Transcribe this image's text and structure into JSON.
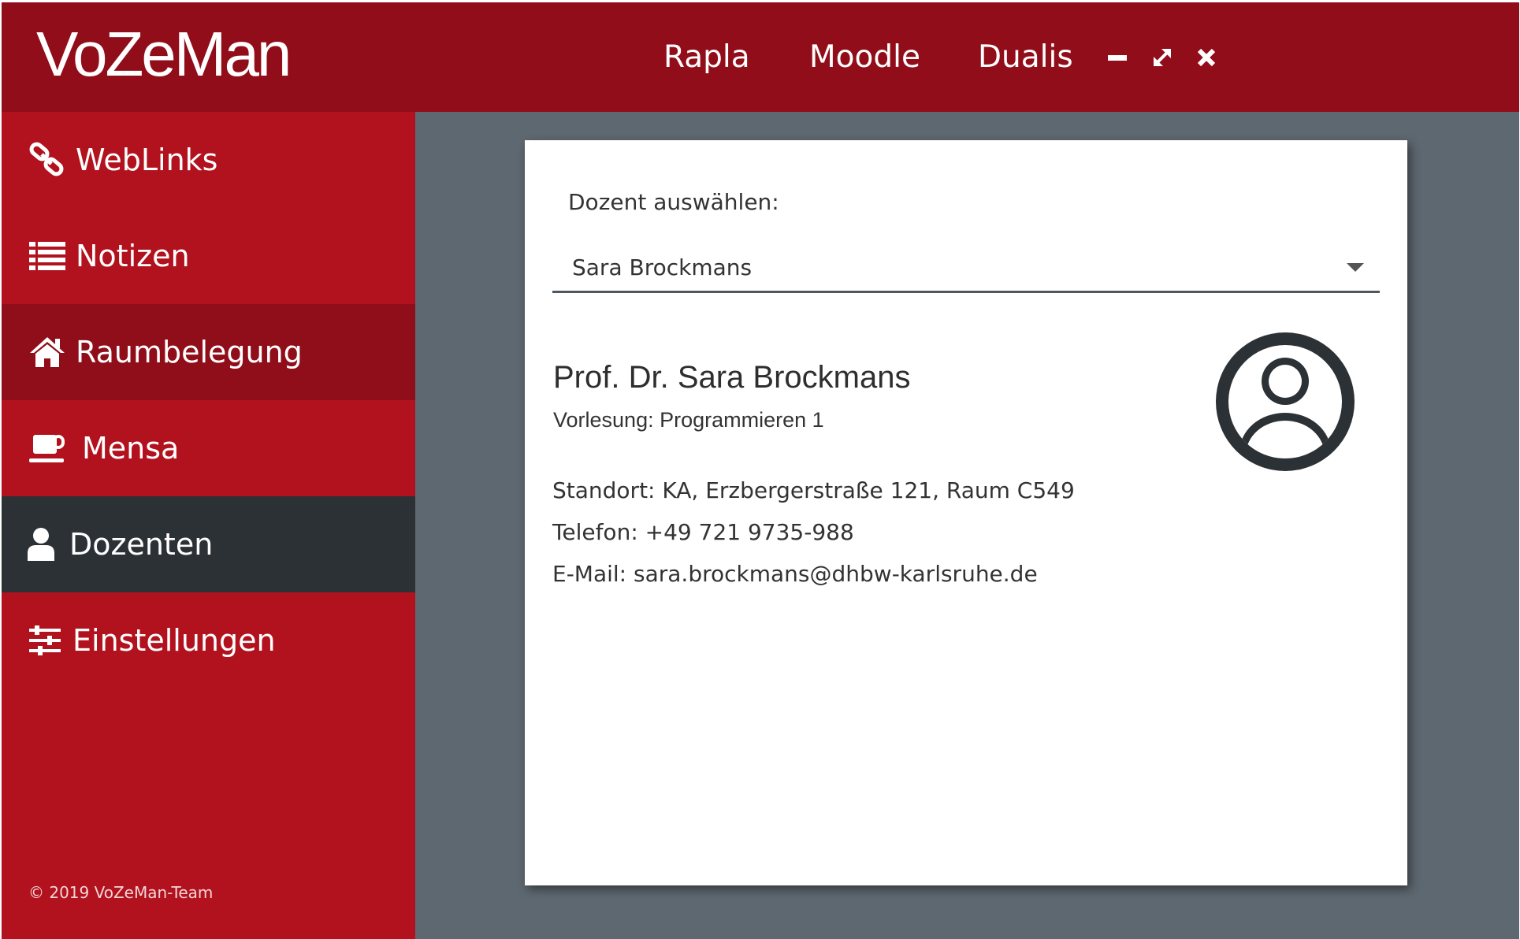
{
  "app": {
    "title": "VoZeMan",
    "top_nav": [
      "Rapla",
      "Moodle",
      "Dualis"
    ],
    "window_controls": [
      "minimize-icon",
      "maximize-icon",
      "close-icon"
    ],
    "colors": {
      "titlebar": "#910d19",
      "sidebar": "#b2121d",
      "sidebar_hover": "#8f0e19",
      "sidebar_active": "#2c3135",
      "content_bg": "#5e6870"
    }
  },
  "sidebar": {
    "items": [
      {
        "label": "WebLinks",
        "icon": "link-icon"
      },
      {
        "label": "Notizen",
        "icon": "list-icon"
      },
      {
        "label": "Raumbelegung",
        "icon": "home-icon"
      },
      {
        "label": "Mensa",
        "icon": "coffee-cup-icon"
      },
      {
        "label": "Dozenten",
        "icon": "user-icon",
        "active": true
      },
      {
        "label": "Einstellungen",
        "icon": "sliders-icon"
      }
    ],
    "footer": "© 2019 VoZeMan-Team"
  },
  "main": {
    "select_label": "Dozent auswählen:",
    "selected_lecturer": "Sara Brockmans",
    "profile": {
      "name": "Prof. Dr. Sara Brockmans",
      "lecture": "Vorlesung: Programmieren 1",
      "location": "Standort: KA, Erzbergerstraße 121, Raum C549",
      "phone": "Telefon: +49 721 9735-988",
      "email": "E-Mail: sara.brockmans@dhbw-karlsruhe.de",
      "avatar_icon": "user-avatar-icon"
    }
  }
}
